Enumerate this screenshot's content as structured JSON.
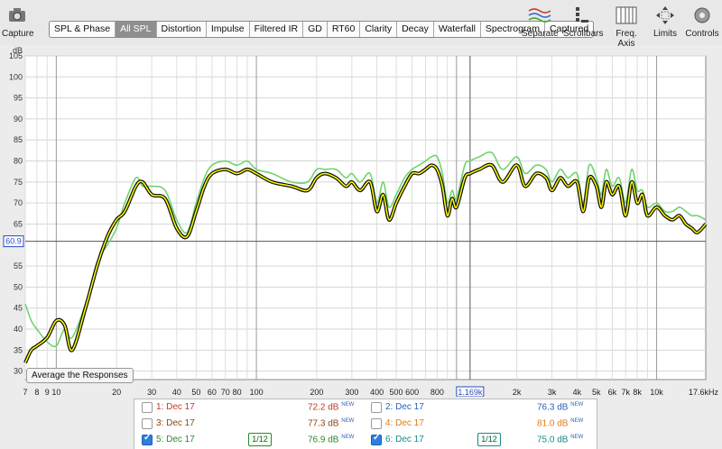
{
  "toolbar": {
    "capture": "Capture",
    "tabs": [
      "SPL & Phase",
      "All SPL",
      "Distortion",
      "Impulse",
      "Filtered IR",
      "GD",
      "RT60",
      "Clarity",
      "Decay",
      "Waterfall",
      "Spectrogram",
      "Captured"
    ],
    "active_tab": "All SPL",
    "right_tools": [
      "Separate",
      "Scrollbars",
      "Freq. Axis",
      "Limits",
      "Controls"
    ]
  },
  "plot": {
    "y_unit": "dB",
    "y_ticks": [
      "105",
      "100",
      "95",
      "90",
      "85",
      "80",
      "75",
      "70",
      "65",
      "60.9",
      "55",
      "50",
      "45",
      "40",
      "35",
      "30"
    ],
    "x_ticks": [
      "7",
      "8",
      "9",
      "10",
      "20",
      "30",
      "40",
      "50",
      "60",
      "70",
      "80",
      "100",
      "200",
      "300",
      "400",
      "500",
      "600",
      "800",
      "1.169k",
      "2k",
      "3k",
      "4k",
      "5k",
      "6k",
      "7k",
      "8k",
      "10k",
      "17.6kHz"
    ],
    "cursor_y": "60.9",
    "cursor_x": "1.169k",
    "average_button": "Average the Responses"
  },
  "legend": [
    {
      "num": "1:",
      "date": "Dec 17",
      "level": "72.2 dB",
      "new": "NEW",
      "checked": false,
      "color": "#c0392b"
    },
    {
      "num": "2:",
      "date": "Dec 17",
      "level": "76.3 dB",
      "new": "NEW",
      "checked": false,
      "color": "#2a60c0"
    },
    {
      "num": "3:",
      "date": "Dec 17",
      "level": "77.3 dB",
      "new": "NEW",
      "checked": false,
      "color": "#8a4a10"
    },
    {
      "num": "4:",
      "date": "Dec 17",
      "level": "81.0 dB",
      "new": "NEW",
      "checked": false,
      "color": "#e07b1a"
    },
    {
      "num": "5:",
      "date": "Dec 17",
      "level": "76.9 dB",
      "new": "NEW",
      "checked": true,
      "color": "#2a8a2a",
      "smoothing": "1/12"
    },
    {
      "num": "6:",
      "date": "Dec 17",
      "level": "75.0 dB",
      "new": "NEW",
      "checked": true,
      "color": "#1a8a8a",
      "smoothing": "1/12"
    }
  ],
  "chart_data": {
    "type": "line",
    "x_scale": "log",
    "xlim": [
      7,
      17600
    ],
    "ylim": [
      28,
      105
    ],
    "ylabel": "dB",
    "series": [
      {
        "color": "#111111",
        "x": [
          7,
          7.5,
          8,
          9,
          10,
          11,
          12,
          14,
          16,
          18,
          20,
          22,
          25,
          27,
          30,
          35,
          40,
          45,
          50,
          55,
          60,
          70,
          80,
          90,
          100,
          120,
          150,
          180,
          200,
          220,
          250,
          280,
          300,
          330,
          370,
          400,
          430,
          460,
          500,
          550,
          600,
          650,
          700,
          750,
          800,
          850,
          900,
          950,
          1000,
          1100,
          1169,
          1300,
          1500,
          1700,
          2000,
          2200,
          2500,
          2800,
          3000,
          3300,
          3600,
          4000,
          4300,
          4600,
          5000,
          5300,
          5600,
          6000,
          6500,
          7000,
          7500,
          8000,
          8500,
          9000,
          10000,
          11000,
          12000,
          13000,
          14000,
          15000,
          16000,
          17600
        ],
        "y": [
          32,
          35,
          36,
          38,
          42,
          41,
          35,
          45,
          55,
          62,
          66,
          68,
          74,
          75,
          72,
          71,
          64,
          62,
          68,
          74,
          77,
          78,
          77,
          78,
          77,
          75,
          74,
          73,
          76,
          77,
          76,
          74,
          75,
          73,
          75,
          68,
          72,
          66,
          70,
          74,
          77,
          77,
          78,
          79,
          78,
          74,
          67,
          71,
          69,
          76,
          77,
          78,
          79,
          75,
          79,
          74,
          77,
          76,
          73,
          76,
          74,
          75,
          68,
          76,
          74,
          69,
          75,
          72,
          74,
          67,
          75,
          70,
          72,
          67,
          69,
          67,
          66,
          67,
          65,
          64,
          63,
          65
        ]
      },
      {
        "color": "#6ed46e",
        "x": [
          7,
          7.5,
          8,
          9,
          10,
          11,
          12,
          14,
          16,
          18,
          20,
          22,
          25,
          27,
          30,
          35,
          40,
          45,
          50,
          55,
          60,
          70,
          80,
          90,
          100,
          120,
          150,
          180,
          200,
          220,
          250,
          280,
          300,
          330,
          370,
          400,
          430,
          460,
          500,
          550,
          600,
          650,
          700,
          750,
          800,
          850,
          900,
          950,
          1000,
          1100,
          1169,
          1300,
          1500,
          1700,
          2000,
          2200,
          2500,
          2800,
          3000,
          3300,
          3600,
          4000,
          4300,
          4600,
          5000,
          5300,
          5600,
          6000,
          6500,
          7000,
          7500,
          8000,
          8500,
          9000,
          10000,
          11000,
          12000,
          13000,
          14000,
          15000,
          16000,
          17600
        ],
        "y": [
          46,
          42,
          40,
          37,
          36,
          40,
          38,
          46,
          56,
          60,
          64,
          70,
          76,
          74,
          74,
          73,
          66,
          63,
          70,
          76,
          79,
          80,
          79,
          80,
          78,
          77,
          75,
          75,
          78,
          78,
          78,
          76,
          77,
          75,
          77,
          70,
          75,
          69,
          72,
          76,
          78,
          79,
          80,
          81,
          81,
          77,
          70,
          73,
          71,
          79,
          80,
          81,
          82,
          78,
          81,
          77,
          79,
          78,
          75,
          78,
          76,
          77,
          70,
          79,
          76,
          72,
          78,
          74,
          76,
          70,
          78,
          73,
          73,
          69,
          70,
          68,
          68,
          69,
          68,
          67,
          67,
          66
        ]
      },
      {
        "color": "#ffff00",
        "x": [
          7,
          7.5,
          8,
          9,
          10,
          11,
          12,
          14,
          16,
          18,
          20,
          22,
          25,
          27,
          30,
          35,
          40,
          45,
          50,
          55,
          60,
          70,
          80,
          90,
          100,
          120,
          150,
          180,
          200,
          220,
          250,
          280,
          300,
          330,
          370,
          400,
          430,
          460,
          500,
          550,
          600,
          650,
          700,
          750,
          800,
          850,
          900,
          950,
          1000,
          1100,
          1169,
          1300,
          1500,
          1700,
          2000,
          2200,
          2500,
          2800,
          3000,
          3300,
          3600,
          4000,
          4300,
          4600,
          5000,
          5300,
          5600,
          6000,
          6500,
          7000,
          7500,
          8000,
          8500,
          9000,
          10000,
          11000,
          12000,
          13000,
          14000,
          15000,
          16000,
          17600
        ],
        "y": [
          32,
          35,
          36,
          38,
          42,
          41,
          35,
          45,
          55,
          62,
          66,
          68,
          74,
          75,
          72,
          71,
          64,
          62,
          68,
          74,
          77,
          78,
          77,
          78,
          77,
          75,
          74,
          73,
          76,
          77,
          76,
          74,
          75,
          73,
          75,
          68,
          72,
          66,
          70,
          74,
          77,
          77,
          78,
          79,
          78,
          74,
          67,
          71,
          69,
          76,
          77,
          78,
          79,
          75,
          79,
          74,
          77,
          76,
          73,
          76,
          74,
          75,
          68,
          76,
          74,
          69,
          75,
          72,
          74,
          67,
          75,
          70,
          72,
          67,
          69,
          67,
          66,
          67,
          65,
          64,
          63,
          65
        ]
      }
    ]
  }
}
